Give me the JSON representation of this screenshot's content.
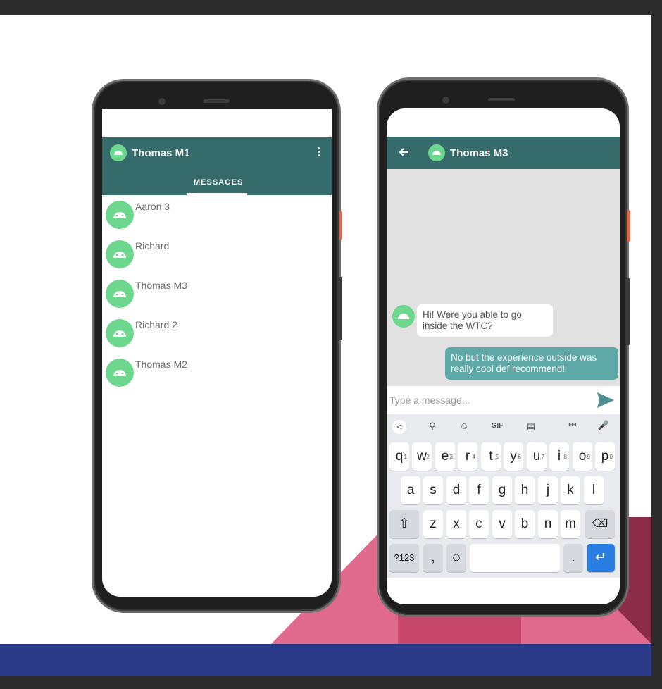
{
  "left_phone": {
    "user_name": "Thomas M1",
    "menu_icon": "overflow-menu-icon",
    "tab_label": "MESSAGES",
    "contacts": [
      {
        "name": "Aaron 3"
      },
      {
        "name": "Richard"
      },
      {
        "name": "Thomas M3"
      },
      {
        "name": "Richard 2"
      },
      {
        "name": "Thomas M2"
      }
    ]
  },
  "right_phone": {
    "chat_title": "Thomas M3",
    "back_icon": "arrow-back-icon",
    "messages": [
      {
        "direction": "incoming",
        "text": "Hi! Were you able to go inside the WTC?"
      },
      {
        "direction": "outgoing",
        "text": "No but the experience outside was really cool def recommend!"
      }
    ],
    "input_placeholder": "Type a message...",
    "send_icon": "send-icon",
    "keyboard": {
      "toolbar": [
        "<",
        "⚲",
        "☺",
        "GIF",
        "▤",
        "•••",
        "🎤"
      ],
      "row1": [
        {
          "k": "q",
          "h": "1"
        },
        {
          "k": "w",
          "h": "2"
        },
        {
          "k": "e",
          "h": "3"
        },
        {
          "k": "r",
          "h": "4"
        },
        {
          "k": "t",
          "h": "5"
        },
        {
          "k": "y",
          "h": "6"
        },
        {
          "k": "u",
          "h": "7"
        },
        {
          "k": "i",
          "h": "8"
        },
        {
          "k": "o",
          "h": "9"
        },
        {
          "k": "p",
          "h": "0"
        }
      ],
      "row2": [
        "a",
        "s",
        "d",
        "f",
        "g",
        "h",
        "j",
        "k",
        "l"
      ],
      "row3": [
        "z",
        "x",
        "c",
        "v",
        "b",
        "n",
        "m"
      ],
      "shift_label": "⇧",
      "backspace_label": "⌫",
      "symbols_label": "?123",
      "comma_label": ",",
      "emoji_label": "☺",
      "period_label": ".",
      "enter_label": "↵"
    }
  },
  "colors": {
    "appbar": "#356b6b",
    "avatar": "#6cd78d",
    "outgoing_bubble": "#5fa8a8",
    "banner": "#2c3a8a",
    "accent_pink": "#e0698e",
    "accent_maroon": "#8c2c4b"
  }
}
